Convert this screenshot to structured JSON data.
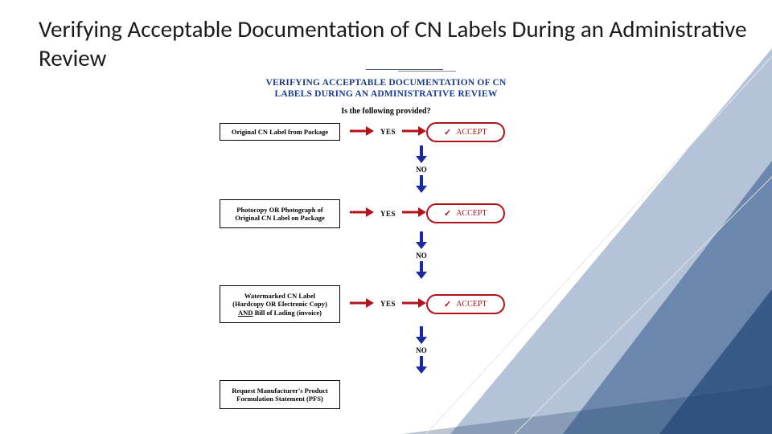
{
  "title": "Verifying Acceptable Documentation of CN Labels During an Administrative Review",
  "flow_header_l1": "VERIFYING ACCEPTABLE DOCUMENTATION OF CN",
  "flow_header_l2": "LABELS DURING AN ADMINISTRATIVE REVIEW",
  "prompt": "Is the following provided?",
  "steps": [
    {
      "label": "Original CN Label from Package",
      "yes": "YES",
      "accept": "ACCEPT",
      "no": "NO"
    },
    {
      "label": "Photocopy OR Photograph of Original CN Label on Package",
      "yes": "YES",
      "accept": "ACCEPT",
      "no": "NO"
    },
    {
      "label_html": "Watermarked CN Label<br>(Hardcopy OR Electronic Copy)<br><span class='u'>AND</span> Bill of Lading (invoice)",
      "yes": "YES",
      "accept": "ACCEPT",
      "no": "NO"
    }
  ],
  "final": "Request Manufacturer's Product Formulation Statement (PFS)",
  "chart_data": {
    "type": "diagram",
    "title": "Verifying Acceptable Documentation of CN Labels During an Administrative Review",
    "nodes": [
      {
        "id": 1,
        "type": "decision",
        "text": "Original CN Label from Package"
      },
      {
        "id": 2,
        "type": "decision",
        "text": "Photocopy OR Photograph of Original CN Label on Package"
      },
      {
        "id": 3,
        "type": "decision",
        "text": "Watermarked CN Label (Hardcopy OR Electronic Copy) AND Bill of Lading (invoice)"
      },
      {
        "id": 4,
        "type": "terminal",
        "text": "Request Manufacturer's Product Formulation Statement (PFS)"
      }
    ],
    "edges": [
      {
        "from": 1,
        "label": "YES",
        "to": "ACCEPT"
      },
      {
        "from": 1,
        "label": "NO",
        "to": 2
      },
      {
        "from": 2,
        "label": "YES",
        "to": "ACCEPT"
      },
      {
        "from": 2,
        "label": "NO",
        "to": 3
      },
      {
        "from": 3,
        "label": "YES",
        "to": "ACCEPT"
      },
      {
        "from": 3,
        "label": "NO",
        "to": 4
      }
    ]
  }
}
